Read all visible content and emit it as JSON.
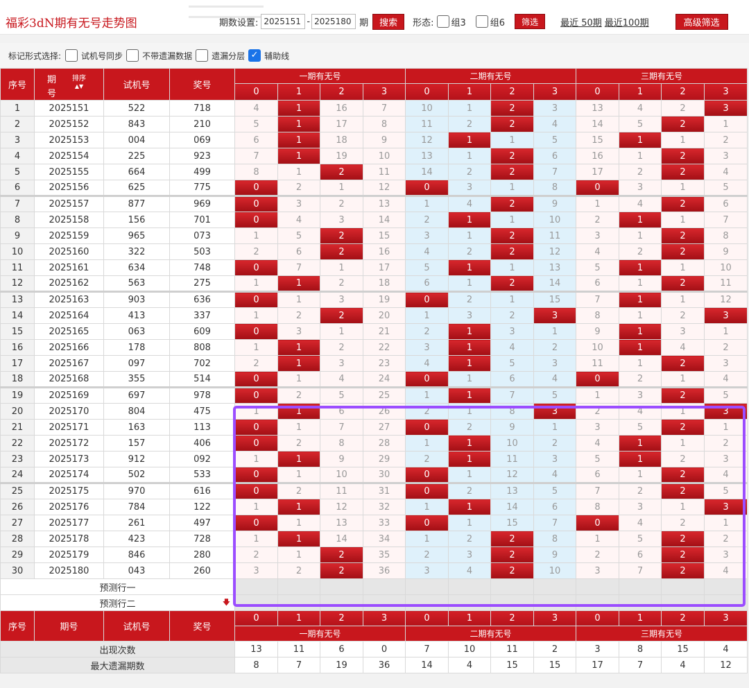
{
  "header": {
    "title": "福彩3dN期有无号走势图",
    "period_label": "期数设置:",
    "period_from": "2025151",
    "period_to": "2025180",
    "period_unit": "期",
    "search_label": "搜索",
    "form_label": "形态:",
    "group3_label": "组3",
    "group6_label": "组6",
    "filter_label": "筛选",
    "recent50_label": "最近 50期",
    "recent100_label": "最近100期",
    "advanced_label": "高级筛选"
  },
  "options": {
    "label": "标记形式选择:",
    "items": [
      {
        "label": "试机号同步",
        "checked": false
      },
      {
        "label": "不带遗漏数据",
        "checked": false
      },
      {
        "label": "遗漏分层",
        "checked": false
      },
      {
        "label": "辅助线",
        "checked": true
      }
    ]
  },
  "table": {
    "col_seq": "序号",
    "col_issue": "期号",
    "col_issue_a": "期",
    "col_issue_b": "号",
    "col_sort": "排序",
    "col_trial": "试机号",
    "col_prize": "奖号",
    "group1": "一期有无号",
    "group2": "二期有无号",
    "group3": "三期有无号",
    "sub_cols": [
      "0",
      "1",
      "2",
      "3"
    ],
    "rows": [
      {
        "seq": "1",
        "issue": "2025151",
        "trial": "522",
        "prize": "718",
        "g1": [
          "4",
          "1",
          "16",
          "7"
        ],
        "g2": [
          "10",
          "1",
          "2",
          "3"
        ],
        "g3": [
          "13",
          "4",
          "2",
          "3"
        ],
        "h1": [
          0,
          1,
          0,
          0
        ],
        "h2": [
          0,
          0,
          1,
          0
        ],
        "h3": [
          0,
          0,
          0,
          1
        ]
      },
      {
        "seq": "2",
        "issue": "2025152",
        "trial": "843",
        "prize": "210",
        "g1": [
          "5",
          "1",
          "17",
          "8"
        ],
        "g2": [
          "11",
          "2",
          "2",
          "4"
        ],
        "g3": [
          "14",
          "5",
          "2",
          "1"
        ],
        "h1": [
          0,
          1,
          0,
          0
        ],
        "h2": [
          0,
          0,
          1,
          0
        ],
        "h3": [
          0,
          0,
          1,
          0
        ]
      },
      {
        "seq": "3",
        "issue": "2025153",
        "trial": "004",
        "prize": "069",
        "g1": [
          "6",
          "1",
          "18",
          "9"
        ],
        "g2": [
          "12",
          "1",
          "1",
          "5"
        ],
        "g3": [
          "15",
          "1",
          "1",
          "2"
        ],
        "h1": [
          0,
          1,
          0,
          0
        ],
        "h2": [
          0,
          1,
          0,
          0
        ],
        "h3": [
          0,
          1,
          0,
          0
        ]
      },
      {
        "seq": "4",
        "issue": "2025154",
        "trial": "225",
        "prize": "923",
        "g1": [
          "7",
          "1",
          "19",
          "10"
        ],
        "g2": [
          "13",
          "1",
          "2",
          "6"
        ],
        "g3": [
          "16",
          "1",
          "2",
          "3"
        ],
        "h1": [
          0,
          1,
          0,
          0
        ],
        "h2": [
          0,
          0,
          1,
          0
        ],
        "h3": [
          0,
          0,
          1,
          0
        ]
      },
      {
        "seq": "5",
        "issue": "2025155",
        "trial": "664",
        "prize": "499",
        "g1": [
          "8",
          "1",
          "2",
          "11"
        ],
        "g2": [
          "14",
          "2",
          "2",
          "7"
        ],
        "g3": [
          "17",
          "2",
          "2",
          "4"
        ],
        "h1": [
          0,
          0,
          1,
          0
        ],
        "h2": [
          0,
          0,
          1,
          0
        ],
        "h3": [
          0,
          0,
          1,
          0
        ]
      },
      {
        "seq": "6",
        "issue": "2025156",
        "trial": "625",
        "prize": "775",
        "g1": [
          "0",
          "2",
          "1",
          "12"
        ],
        "g2": [
          "0",
          "3",
          "1",
          "8"
        ],
        "g3": [
          "0",
          "3",
          "1",
          "5"
        ],
        "h1": [
          1,
          0,
          0,
          0
        ],
        "h2": [
          1,
          0,
          0,
          0
        ],
        "h3": [
          1,
          0,
          0,
          0
        ]
      },
      {
        "seq": "7",
        "issue": "2025157",
        "trial": "877",
        "prize": "969",
        "g1": [
          "0",
          "3",
          "2",
          "13"
        ],
        "g2": [
          "1",
          "4",
          "2",
          "9"
        ],
        "g3": [
          "1",
          "4",
          "2",
          "6"
        ],
        "h1": [
          1,
          0,
          0,
          0
        ],
        "h2": [
          0,
          0,
          1,
          0
        ],
        "h3": [
          0,
          0,
          1,
          0
        ]
      },
      {
        "seq": "8",
        "issue": "2025158",
        "trial": "156",
        "prize": "701",
        "g1": [
          "0",
          "4",
          "3",
          "14"
        ],
        "g2": [
          "2",
          "1",
          "1",
          "10"
        ],
        "g3": [
          "2",
          "1",
          "1",
          "7"
        ],
        "h1": [
          1,
          0,
          0,
          0
        ],
        "h2": [
          0,
          1,
          0,
          0
        ],
        "h3": [
          0,
          1,
          0,
          0
        ]
      },
      {
        "seq": "9",
        "issue": "2025159",
        "trial": "965",
        "prize": "073",
        "g1": [
          "1",
          "5",
          "2",
          "15"
        ],
        "g2": [
          "3",
          "1",
          "2",
          "11"
        ],
        "g3": [
          "3",
          "1",
          "2",
          "8"
        ],
        "h1": [
          0,
          0,
          1,
          0
        ],
        "h2": [
          0,
          0,
          1,
          0
        ],
        "h3": [
          0,
          0,
          1,
          0
        ]
      },
      {
        "seq": "10",
        "issue": "2025160",
        "trial": "322",
        "prize": "503",
        "g1": [
          "2",
          "6",
          "2",
          "16"
        ],
        "g2": [
          "4",
          "2",
          "2",
          "12"
        ],
        "g3": [
          "4",
          "2",
          "2",
          "9"
        ],
        "h1": [
          0,
          0,
          1,
          0
        ],
        "h2": [
          0,
          0,
          1,
          0
        ],
        "h3": [
          0,
          0,
          1,
          0
        ]
      },
      {
        "seq": "11",
        "issue": "2025161",
        "trial": "634",
        "prize": "748",
        "g1": [
          "0",
          "7",
          "1",
          "17"
        ],
        "g2": [
          "5",
          "1",
          "1",
          "13"
        ],
        "g3": [
          "5",
          "1",
          "1",
          "10"
        ],
        "h1": [
          1,
          0,
          0,
          0
        ],
        "h2": [
          0,
          1,
          0,
          0
        ],
        "h3": [
          0,
          1,
          0,
          0
        ]
      },
      {
        "seq": "12",
        "issue": "2025162",
        "trial": "563",
        "prize": "275",
        "g1": [
          "1",
          "1",
          "2",
          "18"
        ],
        "g2": [
          "6",
          "1",
          "2",
          "14"
        ],
        "g3": [
          "6",
          "1",
          "2",
          "11"
        ],
        "h1": [
          0,
          1,
          0,
          0
        ],
        "h2": [
          0,
          0,
          1,
          0
        ],
        "h3": [
          0,
          0,
          1,
          0
        ]
      },
      {
        "seq": "13",
        "issue": "2025163",
        "trial": "903",
        "prize": "636",
        "g1": [
          "0",
          "1",
          "3",
          "19"
        ],
        "g2": [
          "0",
          "2",
          "1",
          "15"
        ],
        "g3": [
          "7",
          "1",
          "1",
          "12"
        ],
        "h1": [
          1,
          0,
          0,
          0
        ],
        "h2": [
          1,
          0,
          0,
          0
        ],
        "h3": [
          0,
          1,
          0,
          0
        ]
      },
      {
        "seq": "14",
        "issue": "2025164",
        "trial": "413",
        "prize": "337",
        "g1": [
          "1",
          "2",
          "2",
          "20"
        ],
        "g2": [
          "1",
          "3",
          "2",
          "3"
        ],
        "g3": [
          "8",
          "1",
          "2",
          "3"
        ],
        "h1": [
          0,
          0,
          1,
          0
        ],
        "h2": [
          0,
          0,
          0,
          1
        ],
        "h3": [
          0,
          0,
          0,
          1
        ]
      },
      {
        "seq": "15",
        "issue": "2025165",
        "trial": "063",
        "prize": "609",
        "g1": [
          "0",
          "3",
          "1",
          "21"
        ],
        "g2": [
          "2",
          "1",
          "3",
          "1"
        ],
        "g3": [
          "9",
          "1",
          "3",
          "1"
        ],
        "h1": [
          1,
          0,
          0,
          0
        ],
        "h2": [
          0,
          1,
          0,
          0
        ],
        "h3": [
          0,
          1,
          0,
          0
        ]
      },
      {
        "seq": "16",
        "issue": "2025166",
        "trial": "178",
        "prize": "808",
        "g1": [
          "1",
          "1",
          "2",
          "22"
        ],
        "g2": [
          "3",
          "1",
          "4",
          "2"
        ],
        "g3": [
          "10",
          "1",
          "4",
          "2"
        ],
        "h1": [
          0,
          1,
          0,
          0
        ],
        "h2": [
          0,
          1,
          0,
          0
        ],
        "h3": [
          0,
          1,
          0,
          0
        ]
      },
      {
        "seq": "17",
        "issue": "2025167",
        "trial": "097",
        "prize": "702",
        "g1": [
          "2",
          "1",
          "3",
          "23"
        ],
        "g2": [
          "4",
          "1",
          "5",
          "3"
        ],
        "g3": [
          "11",
          "1",
          "2",
          "3"
        ],
        "h1": [
          0,
          1,
          0,
          0
        ],
        "h2": [
          0,
          1,
          0,
          0
        ],
        "h3": [
          0,
          0,
          1,
          0
        ]
      },
      {
        "seq": "18",
        "issue": "2025168",
        "trial": "355",
        "prize": "514",
        "g1": [
          "0",
          "1",
          "4",
          "24"
        ],
        "g2": [
          "0",
          "1",
          "6",
          "4"
        ],
        "g3": [
          "0",
          "2",
          "1",
          "4"
        ],
        "h1": [
          1,
          0,
          0,
          0
        ],
        "h2": [
          1,
          0,
          0,
          0
        ],
        "h3": [
          1,
          0,
          0,
          0
        ]
      },
      {
        "seq": "19",
        "issue": "2025169",
        "trial": "697",
        "prize": "978",
        "g1": [
          "0",
          "2",
          "5",
          "25"
        ],
        "g2": [
          "1",
          "1",
          "7",
          "5"
        ],
        "g3": [
          "1",
          "3",
          "2",
          "5"
        ],
        "h1": [
          1,
          0,
          0,
          0
        ],
        "h2": [
          0,
          1,
          0,
          0
        ],
        "h3": [
          0,
          0,
          1,
          0
        ]
      },
      {
        "seq": "20",
        "issue": "2025170",
        "trial": "804",
        "prize": "475",
        "g1": [
          "1",
          "1",
          "6",
          "26"
        ],
        "g2": [
          "2",
          "1",
          "8",
          "3"
        ],
        "g3": [
          "2",
          "4",
          "1",
          "3"
        ],
        "h1": [
          0,
          1,
          0,
          0
        ],
        "h2": [
          0,
          0,
          0,
          1
        ],
        "h3": [
          0,
          0,
          0,
          1
        ]
      },
      {
        "seq": "21",
        "issue": "2025171",
        "trial": "163",
        "prize": "113",
        "g1": [
          "0",
          "1",
          "7",
          "27"
        ],
        "g2": [
          "0",
          "2",
          "9",
          "1"
        ],
        "g3": [
          "3",
          "5",
          "2",
          "1"
        ],
        "h1": [
          1,
          0,
          0,
          0
        ],
        "h2": [
          1,
          0,
          0,
          0
        ],
        "h3": [
          0,
          0,
          1,
          0
        ]
      },
      {
        "seq": "22",
        "issue": "2025172",
        "trial": "157",
        "prize": "406",
        "g1": [
          "0",
          "2",
          "8",
          "28"
        ],
        "g2": [
          "1",
          "1",
          "10",
          "2"
        ],
        "g3": [
          "4",
          "1",
          "1",
          "2"
        ],
        "h1": [
          1,
          0,
          0,
          0
        ],
        "h2": [
          0,
          1,
          0,
          0
        ],
        "h3": [
          0,
          1,
          0,
          0
        ]
      },
      {
        "seq": "23",
        "issue": "2025173",
        "trial": "912",
        "prize": "092",
        "g1": [
          "1",
          "1",
          "9",
          "29"
        ],
        "g2": [
          "2",
          "1",
          "11",
          "3"
        ],
        "g3": [
          "5",
          "1",
          "2",
          "3"
        ],
        "h1": [
          0,
          1,
          0,
          0
        ],
        "h2": [
          0,
          1,
          0,
          0
        ],
        "h3": [
          0,
          1,
          0,
          0
        ]
      },
      {
        "seq": "24",
        "issue": "2025174",
        "trial": "502",
        "prize": "533",
        "g1": [
          "0",
          "1",
          "10",
          "30"
        ],
        "g2": [
          "0",
          "1",
          "12",
          "4"
        ],
        "g3": [
          "6",
          "1",
          "2",
          "4"
        ],
        "h1": [
          1,
          0,
          0,
          0
        ],
        "h2": [
          1,
          0,
          0,
          0
        ],
        "h3": [
          0,
          0,
          1,
          0
        ]
      },
      {
        "seq": "25",
        "issue": "2025175",
        "trial": "970",
        "prize": "616",
        "g1": [
          "0",
          "2",
          "11",
          "31"
        ],
        "g2": [
          "0",
          "2",
          "13",
          "5"
        ],
        "g3": [
          "7",
          "2",
          "2",
          "5"
        ],
        "h1": [
          1,
          0,
          0,
          0
        ],
        "h2": [
          1,
          0,
          0,
          0
        ],
        "h3": [
          0,
          0,
          1,
          0
        ]
      },
      {
        "seq": "26",
        "issue": "2025176",
        "trial": "784",
        "prize": "122",
        "g1": [
          "1",
          "1",
          "12",
          "32"
        ],
        "g2": [
          "1",
          "1",
          "14",
          "6"
        ],
        "g3": [
          "8",
          "3",
          "1",
          "3"
        ],
        "h1": [
          0,
          1,
          0,
          0
        ],
        "h2": [
          0,
          1,
          0,
          0
        ],
        "h3": [
          0,
          0,
          0,
          1
        ]
      },
      {
        "seq": "27",
        "issue": "2025177",
        "trial": "261",
        "prize": "497",
        "g1": [
          "0",
          "1",
          "13",
          "33"
        ],
        "g2": [
          "0",
          "1",
          "15",
          "7"
        ],
        "g3": [
          "0",
          "4",
          "2",
          "1"
        ],
        "h1": [
          1,
          0,
          0,
          0
        ],
        "h2": [
          1,
          0,
          0,
          0
        ],
        "h3": [
          1,
          0,
          0,
          0
        ]
      },
      {
        "seq": "28",
        "issue": "2025178",
        "trial": "423",
        "prize": "728",
        "g1": [
          "1",
          "1",
          "14",
          "34"
        ],
        "g2": [
          "1",
          "2",
          "2",
          "8"
        ],
        "g3": [
          "1",
          "5",
          "2",
          "2"
        ],
        "h1": [
          0,
          1,
          0,
          0
        ],
        "h2": [
          0,
          0,
          1,
          0
        ],
        "h3": [
          0,
          0,
          1,
          0
        ]
      },
      {
        "seq": "29",
        "issue": "2025179",
        "trial": "846",
        "prize": "280",
        "g1": [
          "2",
          "1",
          "2",
          "35"
        ],
        "g2": [
          "2",
          "3",
          "2",
          "9"
        ],
        "g3": [
          "2",
          "6",
          "2",
          "3"
        ],
        "h1": [
          0,
          0,
          1,
          0
        ],
        "h2": [
          0,
          0,
          1,
          0
        ],
        "h3": [
          0,
          0,
          1,
          0
        ]
      },
      {
        "seq": "30",
        "issue": "2025180",
        "trial": "043",
        "prize": "260",
        "g1": [
          "3",
          "2",
          "2",
          "36"
        ],
        "g2": [
          "3",
          "4",
          "2",
          "10"
        ],
        "g3": [
          "3",
          "7",
          "2",
          "4"
        ],
        "h1": [
          0,
          0,
          1,
          0
        ],
        "h2": [
          0,
          0,
          1,
          0
        ],
        "h3": [
          0,
          0,
          1,
          0
        ]
      }
    ],
    "predict1": "预测行一",
    "predict2": "预测行二",
    "stats": [
      {
        "label": "出现次数",
        "values": [
          "13",
          "11",
          "6",
          "0",
          "7",
          "10",
          "11",
          "2",
          "3",
          "8",
          "15",
          "4"
        ]
      },
      {
        "label": "最大遗漏期数",
        "values": [
          "8",
          "7",
          "19",
          "36",
          "14",
          "4",
          "15",
          "15",
          "17",
          "7",
          "4",
          "12"
        ]
      }
    ]
  },
  "colors": {
    "accent": "#c8171d",
    "highlight": "#9b4dff",
    "blue_group": "#dff1fb"
  }
}
